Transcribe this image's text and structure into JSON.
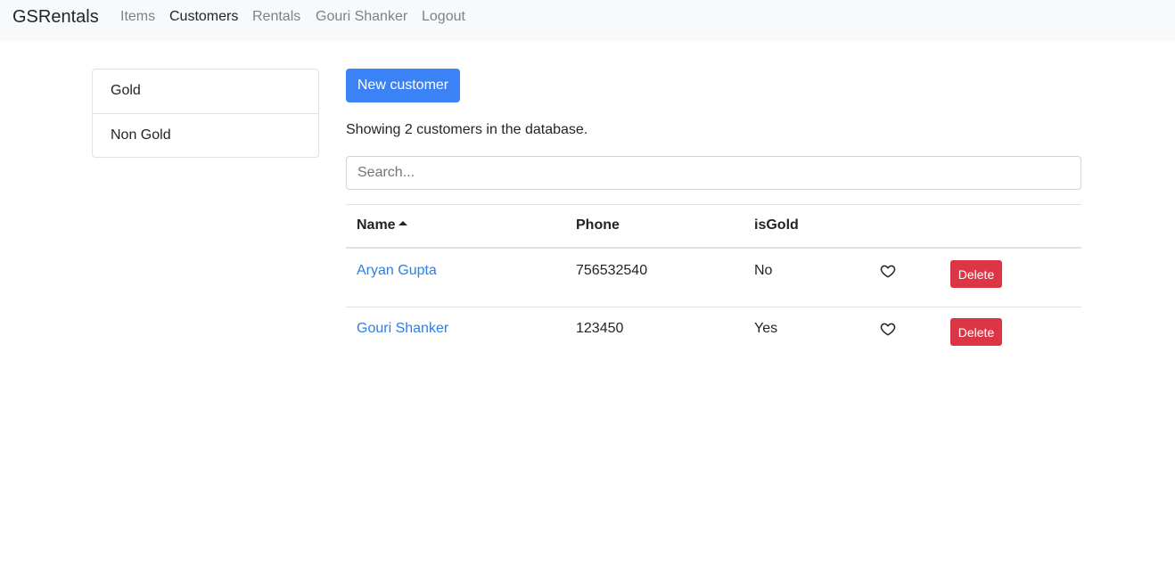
{
  "navbar": {
    "brand": "GSRentals",
    "links": [
      {
        "label": "Items",
        "active": false
      },
      {
        "label": "Customers",
        "active": true
      },
      {
        "label": "Rentals",
        "active": false
      },
      {
        "label": "Gouri Shanker",
        "active": false
      },
      {
        "label": "Logout",
        "active": false
      }
    ]
  },
  "filters": [
    "Gold",
    "Non Gold"
  ],
  "new_button_label": "New customer",
  "summary": "Showing 2 customers in the database.",
  "search": {
    "placeholder": "Search...",
    "value": ""
  },
  "table": {
    "columns": [
      "Name",
      "Phone",
      "isGold"
    ],
    "sort_column": "Name",
    "sort_direction": "asc",
    "rows": [
      {
        "name": "Aryan Gupta",
        "phone": "756532540",
        "isGold": "No",
        "liked": false,
        "action_label": "Delete"
      },
      {
        "name": "Gouri Shanker",
        "phone": "123450",
        "isGold": "Yes",
        "liked": false,
        "action_label": "Delete"
      }
    ]
  },
  "colors": {
    "primary": "#3b82f6",
    "danger": "#dc3545",
    "link": "#2d7ee8",
    "navbar_bg": "#f8f9fa"
  },
  "icons": {
    "like": "heart-outline-icon",
    "sort": "caret-up-icon"
  }
}
